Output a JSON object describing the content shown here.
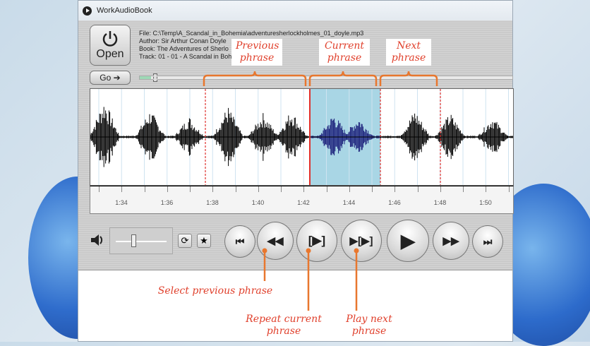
{
  "window": {
    "title": "WorkAudioBook"
  },
  "toolbar": {
    "open_label": "Open",
    "go_label": "Go"
  },
  "info": {
    "file_label": "File:",
    "file": "C:\\Temp\\A_Scandal_in_Bohemia\\adventuresherlockholmes_01_doyle.mp3",
    "author_label": "Author:",
    "author": "Sir Arthur Conan Doyle",
    "book_label": "Book:",
    "book": "The Adventures of Sherlo",
    "track_label": "Track:",
    "track": "01 - 01 - A Scandal in Boh"
  },
  "progress": {
    "fraction": 0.03
  },
  "timeline": {
    "labels": [
      "1:34",
      "1:36",
      "1:38",
      "1:40",
      "1:42",
      "1:44",
      "1:46",
      "1:48",
      "1:50"
    ]
  },
  "volume": {
    "level": 0.4
  },
  "controls": {
    "loop": "⟳",
    "favorite": "★",
    "first": "⏮",
    "prev": "◀◀",
    "repeat": "[▶]",
    "next_phrase": "▶[▶]",
    "play": "▶",
    "forward": "▶▶",
    "last": "⏭"
  },
  "annotations": {
    "previous": "Previous phrase",
    "current": "Current phrase",
    "next": "Next phrase",
    "select_prev": "Select previous phrase",
    "repeat_current": "Repeat current phrase",
    "play_next": "Play next phrase"
  },
  "colors": {
    "accent": "#e0402c",
    "brace": "#e8772e",
    "selection": "#a9d6e5",
    "wave": "#000000",
    "wave_selected": "#1b1f7a"
  }
}
